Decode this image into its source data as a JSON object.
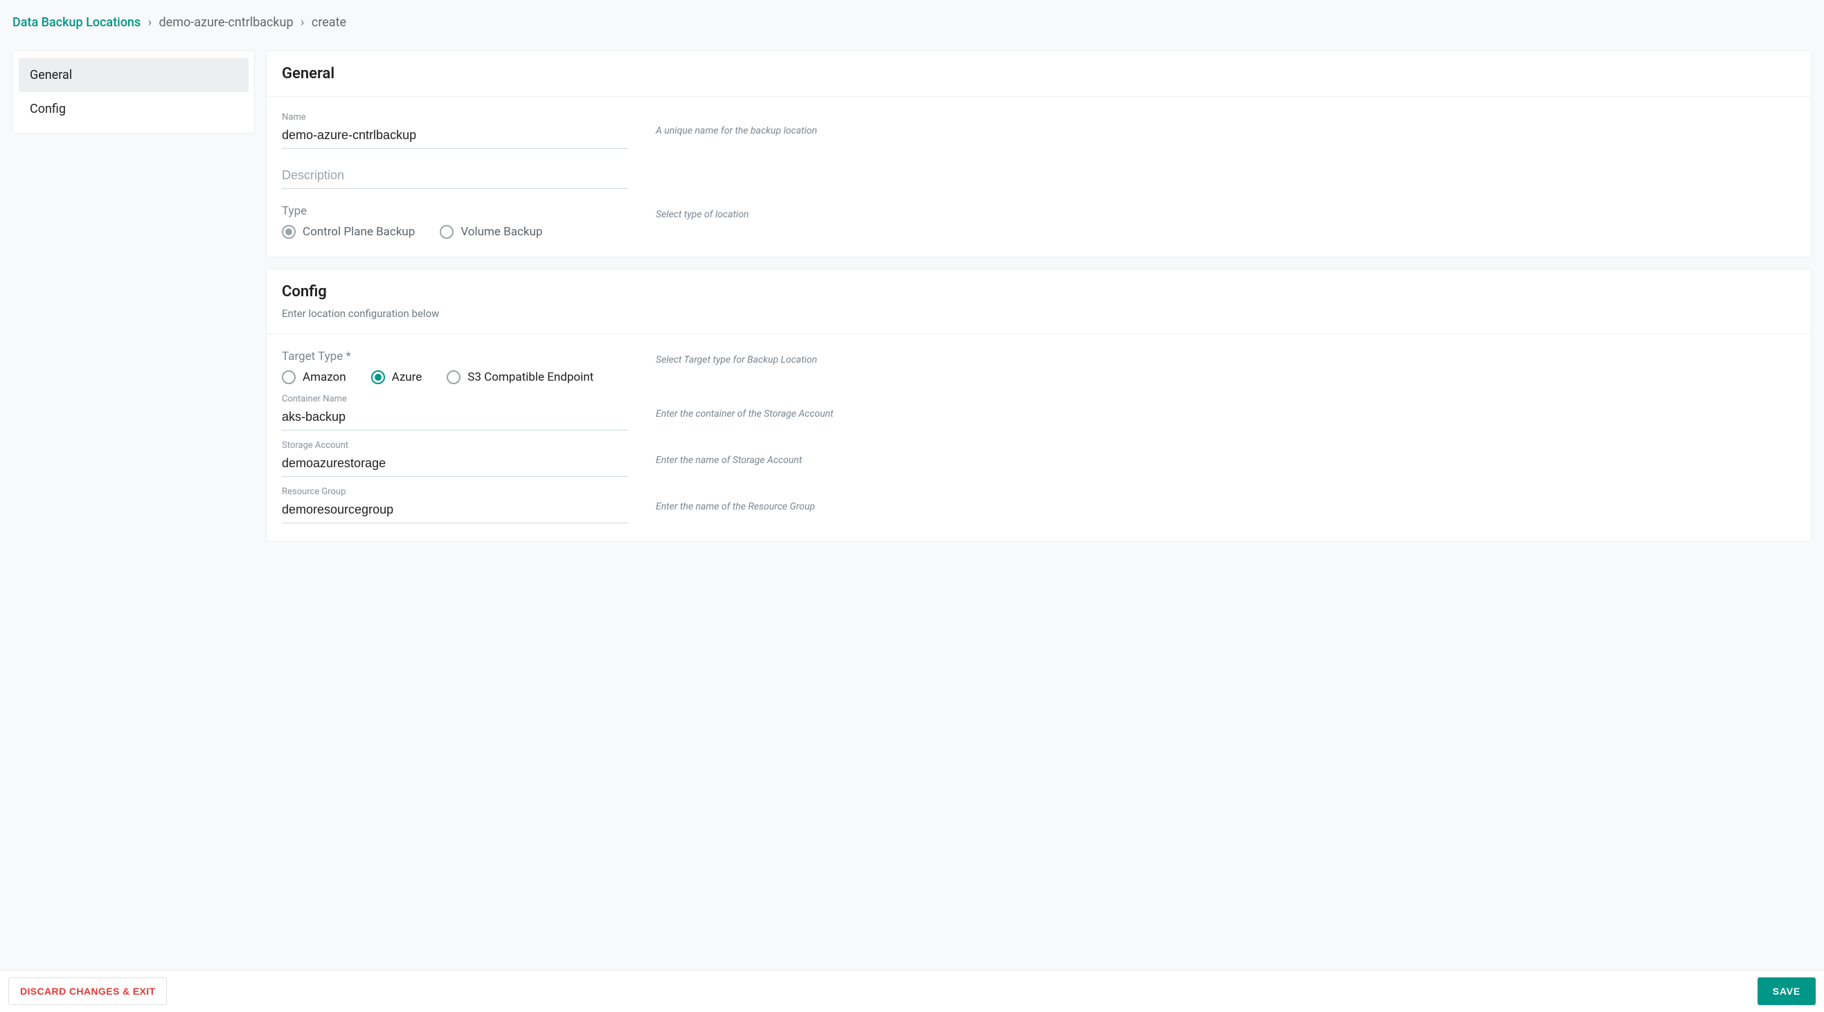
{
  "breadcrumb": {
    "root": "Data Backup Locations",
    "level1": "demo-azure-cntrlbackup",
    "level2": "create",
    "separator": "›"
  },
  "sidebar": {
    "items": [
      {
        "label": "General",
        "active": true
      },
      {
        "label": "Config",
        "active": false
      }
    ]
  },
  "general": {
    "title": "General",
    "name_label": "Name",
    "name_value": "demo-azure-cntrlbackup",
    "name_help": "A unique name for the backup location",
    "description_placeholder": "Description",
    "type_label": "Type",
    "type_help": "Select type of location",
    "type_options": {
      "control_plane": "Control Plane Backup",
      "volume": "Volume Backup"
    },
    "type_selected": "control_plane"
  },
  "config": {
    "title": "Config",
    "subtitle": "Enter location configuration below",
    "target_type_label": "Target Type *",
    "target_type_help": "Select Target type for Backup Location",
    "target_type_options": {
      "amazon": "Amazon",
      "azure": "Azure",
      "s3compat": "S3 Compatible Endpoint"
    },
    "target_type_selected": "azure",
    "container_label": "Container Name",
    "container_value": "aks-backup",
    "container_help": "Enter the container of the Storage Account",
    "storage_label": "Storage Account",
    "storage_value": "demoazurestorage",
    "storage_help": "Enter the name of Storage Account",
    "resource_group_label": "Resource Group",
    "resource_group_value": "demoresourcegroup",
    "resource_group_help": "Enter the name of the Resource Group"
  },
  "footer": {
    "discard": "DISCARD CHANGES & EXIT",
    "save": "SAVE"
  }
}
